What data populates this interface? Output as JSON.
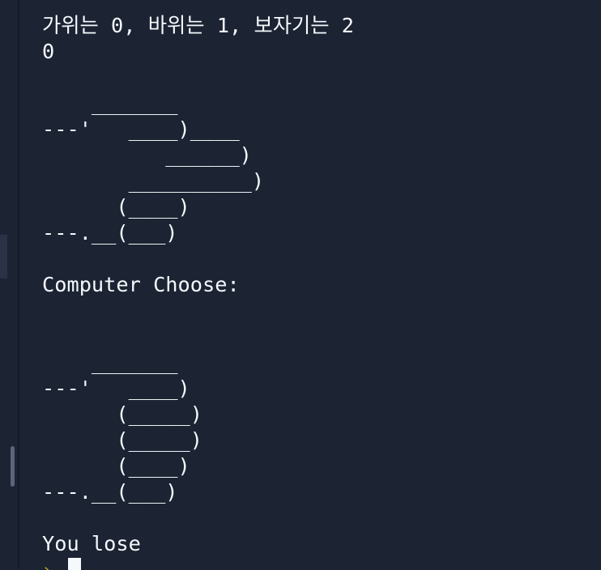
{
  "terminal": {
    "lines": [
      "가위는 0, 바위는 1, 보자기는 2",
      "0",
      "",
      "    _______",
      "---'   ____)____",
      "          ______)",
      "       __________)",
      "      (____)",
      "---.__(___)",
      "",
      "Computer Choose:",
      "",
      "",
      "    _______",
      "---'   ____)",
      "      (_____)",
      "      (_____)",
      "      (____)",
      "---.__(___)",
      "",
      "You lose"
    ],
    "prompt_symbol": "›"
  },
  "colors": {
    "background": "#1c2333",
    "text": "#f5f9fc",
    "prompt": "#b89a2c"
  },
  "icons": {
    "prompt": "prompt-chevron-icon"
  }
}
